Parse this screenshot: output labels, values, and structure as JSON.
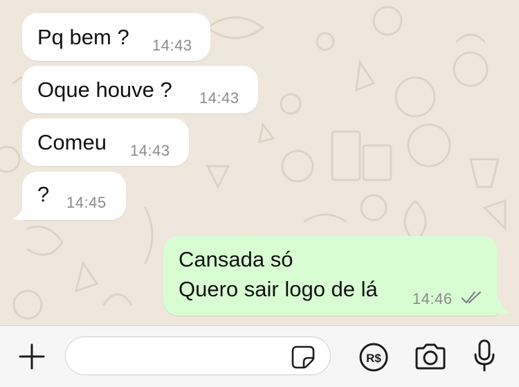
{
  "messages": [
    {
      "direction": "incoming",
      "text": "Pq bem ?",
      "time": "14:43"
    },
    {
      "direction": "incoming",
      "text": "Oque houve ?",
      "time": "14:43"
    },
    {
      "direction": "incoming",
      "text": "Comeu",
      "time": "14:43"
    },
    {
      "direction": "incoming",
      "text": "?",
      "time": "14:45"
    },
    {
      "direction": "outgoing",
      "text_line1": "Cansada só",
      "text_line2": "Quero sair logo de lá",
      "time": "14:46",
      "status": "read-double-check"
    }
  ],
  "composer": {
    "placeholder": "",
    "icons": [
      "plus-icon",
      "sticker-icon",
      "pix-real-icon",
      "camera-icon",
      "microphone-icon"
    ]
  },
  "colors": {
    "incoming_bubble": "#ffffff",
    "outgoing_bubble": "#d9fdd3",
    "wallpaper": "#efe7dc",
    "timestamp": "#8a8a8a"
  }
}
